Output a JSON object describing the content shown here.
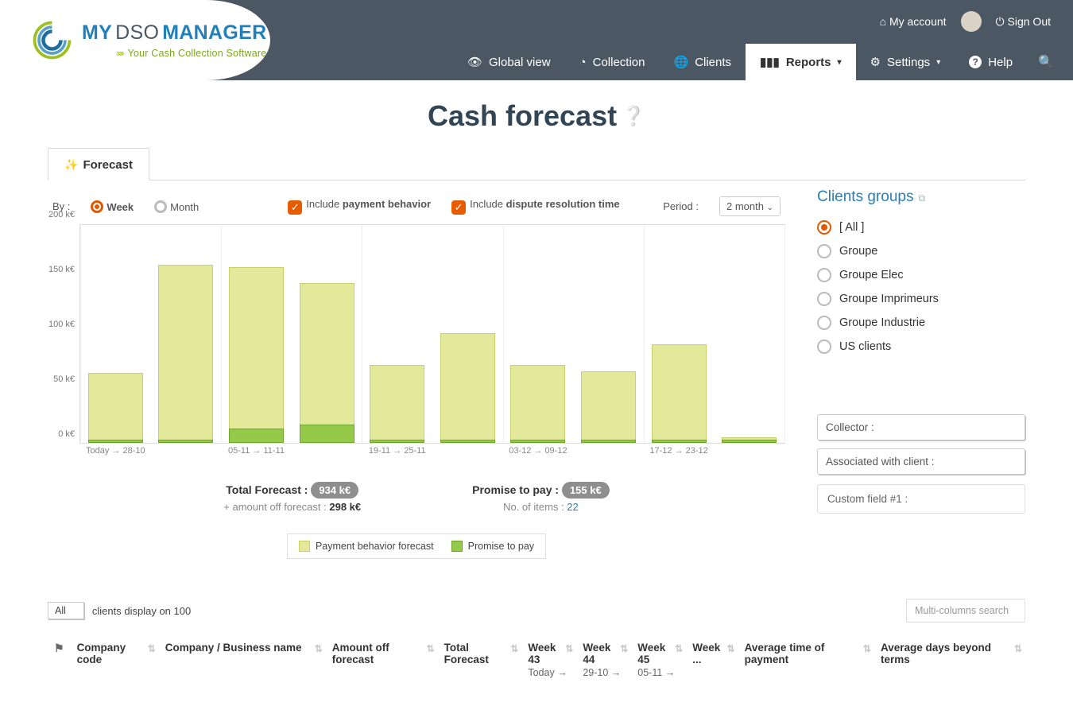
{
  "header": {
    "my_account": "My account",
    "sign_out": "Sign Out",
    "nav": {
      "global": "Global view",
      "collection": "Collection",
      "clients": "Clients",
      "reports": "Reports",
      "settings": "Settings",
      "help": "Help"
    },
    "logo": {
      "my": "MY",
      "dso": "DSO",
      "mgr": "MANAGER",
      "sub": "Your Cash Collection Software"
    }
  },
  "page_title": "Cash forecast",
  "tab_label": "Forecast",
  "controls": {
    "by_label": "By :",
    "week": "Week",
    "month": "Month",
    "include_pb_pre": "Include ",
    "include_pb_bold": "payment behavior",
    "include_dr_pre": "Include ",
    "include_dr_bold": "dispute resolution time",
    "period_label": "Period :",
    "period_value": "2 month"
  },
  "chart_data": {
    "type": "bar",
    "ylabel": "k€",
    "ylim": [
      0,
      200
    ],
    "y_ticks": [
      0,
      50,
      100,
      150,
      200
    ],
    "categories_idx": [
      0,
      1,
      2,
      3,
      4,
      5,
      6,
      7,
      8,
      9
    ],
    "x_labels": {
      "0": "Today → 28-10",
      "2": "05-11 → 11-11",
      "4": "19-11 → 25-11",
      "6": "03-12 → 09-12",
      "8": "17-12 → 23-12"
    },
    "series": [
      {
        "name": "Payment behavior forecast",
        "values": [
          64,
          162,
          160,
          146,
          71,
          100,
          71,
          65,
          90,
          5
        ]
      },
      {
        "name": "Promise to pay",
        "values": [
          3,
          3,
          13,
          17,
          3,
          3,
          3,
          3,
          3,
          3
        ]
      }
    ]
  },
  "summary": {
    "total_label": "Total Forecast :",
    "total_value": "934 k€",
    "off_label": "+ amount off forecast :",
    "off_value": "298 k€",
    "promise_label": "Promise to pay :",
    "promise_value": "155 k€",
    "items_label": "No. of items :",
    "items_value": "22"
  },
  "legend": {
    "a": "Payment behavior forecast",
    "b": "Promise to pay"
  },
  "groups": {
    "title": "Clients groups",
    "items": [
      "[ All ]",
      "Groupe",
      "Groupe Elec",
      "Groupe Imprimeurs",
      "Groupe Industrie",
      "US clients"
    ],
    "selected_index": 0,
    "collector": "Collector :",
    "assoc": "Associated with client :",
    "custom": "Custom field #1 :"
  },
  "table_controls": {
    "all": "All",
    "clients_display": "clients display on 100",
    "search_placeholder": "Multi-columns search"
  },
  "table_headers": {
    "company_code": "Company code",
    "company_name": "Company / Business name",
    "amount_off": "Amount off forecast",
    "total_forecast": "Total Forecast",
    "w43": "Week 43",
    "w43s": "Today →",
    "w44": "Week 44",
    "w44s": "29-10 →",
    "w45": "Week 45",
    "w45s": "05-11 →",
    "wmore": "Week ...",
    "avg_time": "Average time of payment",
    "avg_days": "Average days beyond terms"
  }
}
